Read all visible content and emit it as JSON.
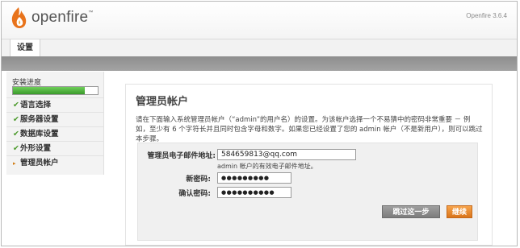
{
  "header": {
    "brand": "openfire",
    "trademark": "™",
    "version": "Openfire 3.6.4"
  },
  "tabs": [
    {
      "label": "设置"
    }
  ],
  "sidebar": {
    "progress_label": "安装进度",
    "progress_fraction": 0.85,
    "steps": [
      {
        "label": "语言选择",
        "mark": "✔",
        "status": "done"
      },
      {
        "label": "服务器设置",
        "mark": "✔",
        "status": "done"
      },
      {
        "label": "数据库设置",
        "mark": "✔",
        "status": "done"
      },
      {
        "label": "外形设置",
        "mark": "✔",
        "status": "done"
      },
      {
        "label": "管理员帐户",
        "mark": "▸",
        "status": "current"
      }
    ]
  },
  "main": {
    "title": "管理员帐户",
    "description": "请在下面输入系统管理员帐户（“admin”的用户名）的设置。为该帐户选择一个不易猜中的密码非常重要 － 例如，至少有 6 个字符长并且同时包含字母和数字。如果您已经设置了您的 admin 帐户（不是新用户），则可以跳过本步骤。",
    "form": {
      "email_label": "管理员电子邮件地址:",
      "email_value": "584659813@qq.com",
      "email_hint": "admin 帐户的有效电子邮件地址。",
      "password_label": "新密码:",
      "password_value": "●●●●●●●●●",
      "confirm_label": "确认密码:",
      "confirm_value": "●●●●●●●●●●"
    },
    "buttons": {
      "skip": "跳过这一步",
      "next": "继续"
    }
  },
  "colors": {
    "progress": "#3a9a2b",
    "check": "#4a9a2a",
    "next_button": "#d9741a",
    "skip_button": "#7c7c7c"
  }
}
